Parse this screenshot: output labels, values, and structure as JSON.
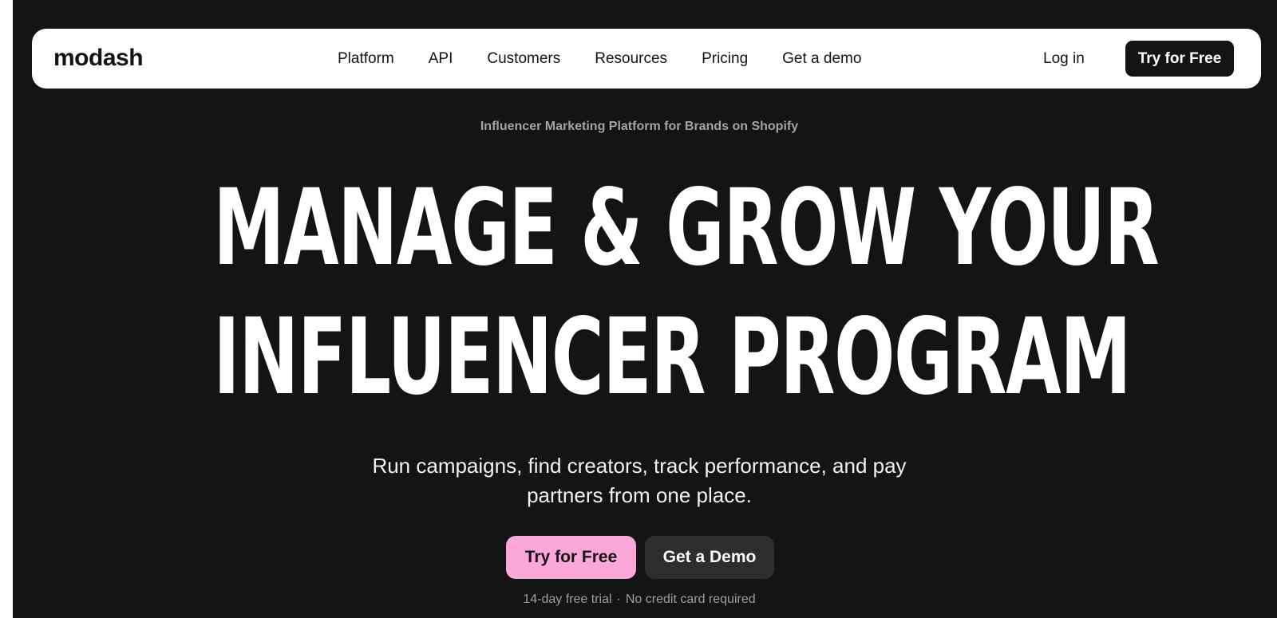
{
  "navbar": {
    "logo": "modash",
    "links": [
      "Platform",
      "API",
      "Customers",
      "Resources",
      "Pricing",
      "Get a demo"
    ],
    "login": "Log in",
    "cta": "Try for Free"
  },
  "hero": {
    "eyebrow": "Influencer Marketing Platform for Brands on Shopify",
    "headline_line1": "MANAGE & GROW YOUR",
    "headline_line2": "INFLUENCER PROGRAM",
    "subtext_line1": "Run campaigns, find creators, track performance, and pay",
    "subtext_line2": "partners from one place.",
    "primary_cta": "Try for Free",
    "secondary_cta": "Get a Demo",
    "footnote_part1": "14-day free trial",
    "footnote_separator": "·",
    "footnote_part2": "No credit card required"
  },
  "colors": {
    "background": "#141414",
    "primary_button": "#fba7d7",
    "secondary_button": "#2d2d2d",
    "navbar": "#ffffff"
  }
}
